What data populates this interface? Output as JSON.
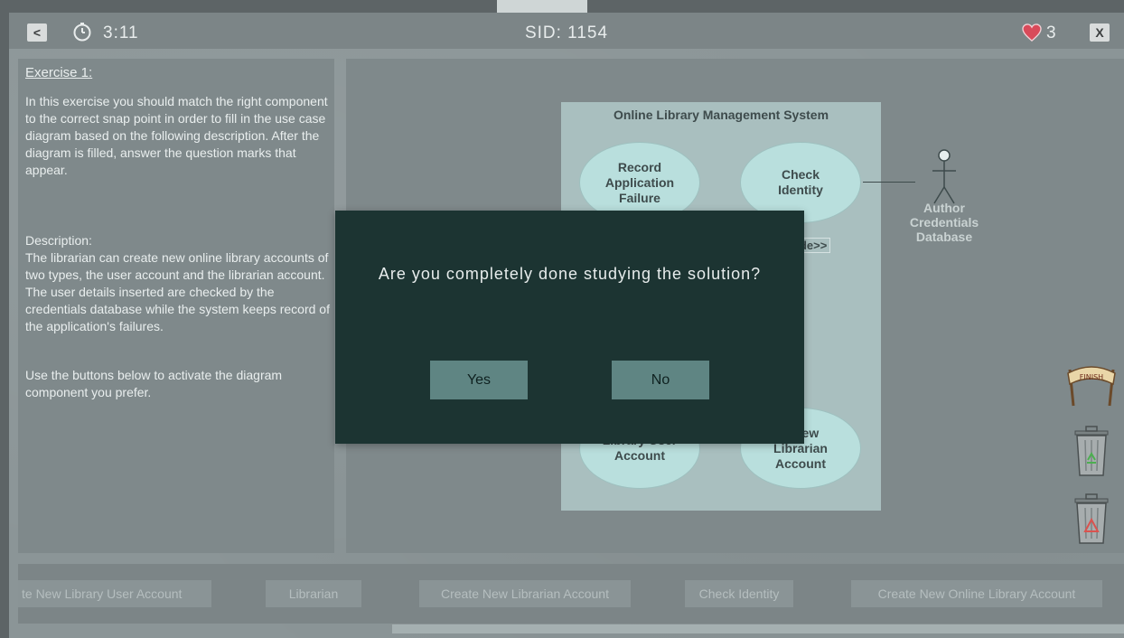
{
  "topbar": {
    "back_label": "<",
    "timer": "3:11",
    "sid": "SID: 1154",
    "lives": "3",
    "close_label": "X"
  },
  "instructions": {
    "title": "Exercise 1:",
    "intro": "In this exercise you should match the right component to the correct snap point in order to fill in the use case diagram based on the following description. After the diagram is filled, answer the question marks that appear.",
    "description_heading": "Description:",
    "description": "The librarian can create new online library accounts of two types, the user account and the librarian account. The user details inserted are checked by the credentials database while the system keeps record of the application's failures.",
    "hint": "Use the buttons below to activate the diagram component you prefer."
  },
  "diagram": {
    "system_title": "Online Library Management System",
    "use_cases": {
      "record_failure": "Record\nApplication\nFailure",
      "check_identity": "Check\nIdentity",
      "library_user_account": "Library User\nAccount",
      "librarian_account": "e New\nLibrarian\nAccount"
    },
    "include_label": "ude>>",
    "actor_label": "Author\nCredentials\nDatabase"
  },
  "side_icons": {
    "finish_label": "FINISH"
  },
  "palette": {
    "items": [
      "te New Library User Account",
      "Librarian",
      "Create New Librarian Account",
      "Check Identity",
      "Create New Online Library Account"
    ]
  },
  "dialog": {
    "message": "Are you completely done studying the solution?",
    "yes_label": "Yes",
    "no_label": "No"
  },
  "colors": {
    "dialog_bg": "#1c3432",
    "dialog_button": "#5f8583",
    "use_case_fill": "#b9dfdd",
    "system_box": "#a9bfbf",
    "heart": "#d94a5a"
  }
}
